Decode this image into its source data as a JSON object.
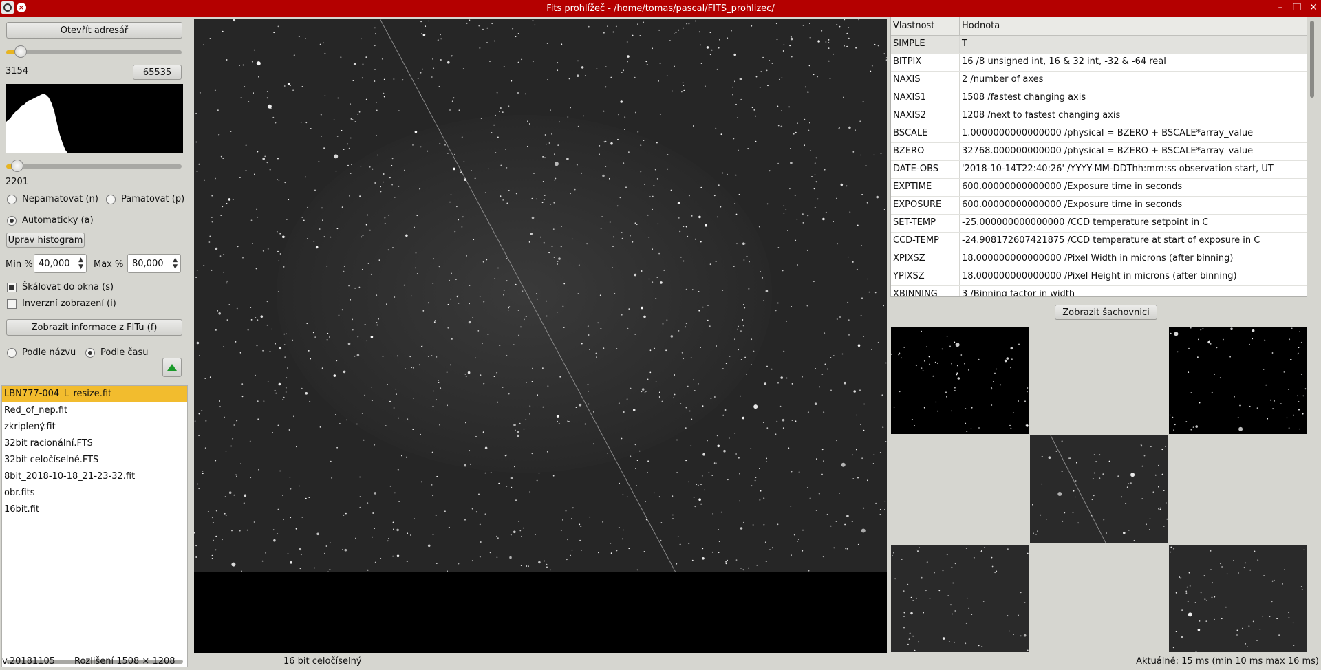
{
  "window": {
    "title": "Fits prohlížeč - /home/tomas/pascal/FITS_prohlizec/",
    "buttons": [
      "minimize-icon",
      "maximize-icon",
      "close-icon"
    ]
  },
  "left": {
    "open_dir_label": "Otevřít adresář",
    "max_value_label": "3154",
    "max_button_label": "65535",
    "max_slider_fraction": 0.05,
    "min_slider_fraction": 0.03,
    "min_value_label": "2201",
    "radio_no_remember": "Nepamatovat (n)",
    "radio_remember": "Pamatovat (p)",
    "radio_auto": "Automaticky (a)",
    "edit_histogram_label": "Uprav histogram",
    "min_pct_label": "Min %",
    "min_pct_value": "40,000",
    "max_pct_label": "Max %",
    "max_pct_value": "80,000",
    "scale_to_window_label": "Škálovat do okna (s)",
    "inverse_label": "Inverzní zobrazení (i)",
    "show_fits_info_label": "Zobrazit informace z FITu (f)",
    "sort_by_name_label": "Podle názvu",
    "sort_by_time_label": "Podle času",
    "files": [
      "LBN777-004_L_resize.fit",
      "Red_of_nep.fit",
      "zkriplený.fit",
      "32bit racionální.FTS",
      "32bit celočíselné.FTS",
      "8bit_2018-10-18_21-23-32.fit",
      "obr.fits",
      "16bit.fit"
    ]
  },
  "table": {
    "col_property": "Vlastnost",
    "col_value": "Hodnota",
    "rows": [
      {
        "k": "SIMPLE",
        "v": "T"
      },
      {
        "k": "BITPIX",
        "v": "16 /8 unsigned int, 16 & 32 int, -32 & -64 real"
      },
      {
        "k": "NAXIS",
        "v": "2 /number of axes"
      },
      {
        "k": "NAXIS1",
        "v": "1508 /fastest changing axis"
      },
      {
        "k": "NAXIS2",
        "v": "1208 /next to fastest changing axis"
      },
      {
        "k": "BSCALE",
        "v": "1.0000000000000000 /physical = BZERO + BSCALE*array_value"
      },
      {
        "k": "BZERO",
        "v": "32768.000000000000 /physical = BZERO + BSCALE*array_value"
      },
      {
        "k": "DATE-OBS",
        "v": "'2018-10-14T22:40:26' /YYYY-MM-DDThh:mm:ss observation start, UT"
      },
      {
        "k": "EXPTIME",
        "v": "600.00000000000000 /Exposure time in seconds"
      },
      {
        "k": "EXPOSURE",
        "v": "600.00000000000000 /Exposure time in seconds"
      },
      {
        "k": "SET-TEMP",
        "v": "-25.000000000000000 /CCD temperature setpoint in C"
      },
      {
        "k": "CCD-TEMP",
        "v": "-24.908172607421875 /CCD temperature at start of exposure in C"
      },
      {
        "k": "XPIXSZ",
        "v": "18.000000000000000 /Pixel Width in microns (after binning)"
      },
      {
        "k": "YPIXSZ",
        "v": "18.000000000000000 /Pixel Height in microns (after binning)"
      },
      {
        "k": "XBINNING",
        "v": "3 /Binning factor in width"
      }
    ]
  },
  "checker_button_label": "Zobrazit šachovnici",
  "status": {
    "version": "v.20181105",
    "resolution": "Rozlišení 1508 × 1208",
    "bitdepth": "16 bit celočíselný",
    "timing": "Aktuálně: 15 ms (min 10 ms  max 16 ms)"
  },
  "colors": {
    "titlebar": "#b40000",
    "accent": "#e8b520",
    "selected_file": "#f2bc2e",
    "background": "#d6d6d0"
  }
}
